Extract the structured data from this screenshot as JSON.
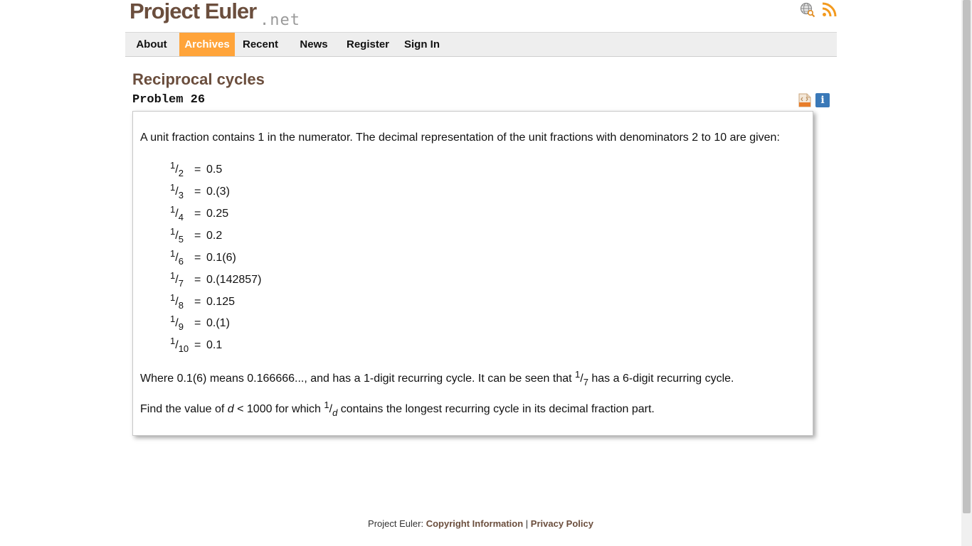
{
  "header": {
    "logo_main": "Project Euler",
    "logo_net": ".net",
    "icons": [
      "search-globe-icon",
      "rss-feed-icon"
    ]
  },
  "nav": {
    "items": [
      {
        "label": "About",
        "active": false
      },
      {
        "label": "Archives",
        "active": true
      },
      {
        "label": "Recent",
        "active": false
      },
      {
        "label": "News",
        "active": false
      },
      {
        "label": "Register",
        "active": false
      },
      {
        "label": "Sign In",
        "active": false
      }
    ]
  },
  "problem": {
    "title": "Reciprocal cycles",
    "number_label": "Problem 26",
    "tool_icons": [
      "html-file-icon",
      "info-icon"
    ],
    "info_glyph": "i",
    "intro": "A unit fraction contains 1 in the numerator. The decimal representation of the unit fractions with denominators 2 to 10 are given:",
    "fractions": [
      {
        "num": "1",
        "den": "2",
        "value": "0.5"
      },
      {
        "num": "1",
        "den": "3",
        "value": "0.(3)"
      },
      {
        "num": "1",
        "den": "4",
        "value": "0.25"
      },
      {
        "num": "1",
        "den": "5",
        "value": "0.2"
      },
      {
        "num": "1",
        "den": "6",
        "value": "0.1(6)"
      },
      {
        "num": "1",
        "den": "7",
        "value": "0.(142857)"
      },
      {
        "num": "1",
        "den": "8",
        "value": "0.125"
      },
      {
        "num": "1",
        "den": "9",
        "value": "0.(1)"
      },
      {
        "num": "1",
        "den": "10",
        "value": "0.1"
      }
    ],
    "equals": "=",
    "slash": "/",
    "para2_a": "Where 0.1(6) means 0.166666..., and has a 1-digit recurring cycle. It can be seen that ",
    "para2_num": "1",
    "para2_den": "7",
    "para2_b": " has a 6-digit recurring cycle.",
    "para3_a": "Find the value of ",
    "para3_var": "d",
    "para3_b": " < 1000 for which ",
    "para3_num": "1",
    "para3_den": "d",
    "para3_c": " contains the longest recurring cycle in its decimal fraction part."
  },
  "footer": {
    "prefix": "Project Euler: ",
    "copyright_link": "Copyright Information",
    "separator": " | ",
    "privacy_link": "Privacy Policy"
  },
  "colors": {
    "brand_brown": "#6b4e3d",
    "nav_active": "#ffa43a",
    "info_blue": "#3a79b8"
  }
}
